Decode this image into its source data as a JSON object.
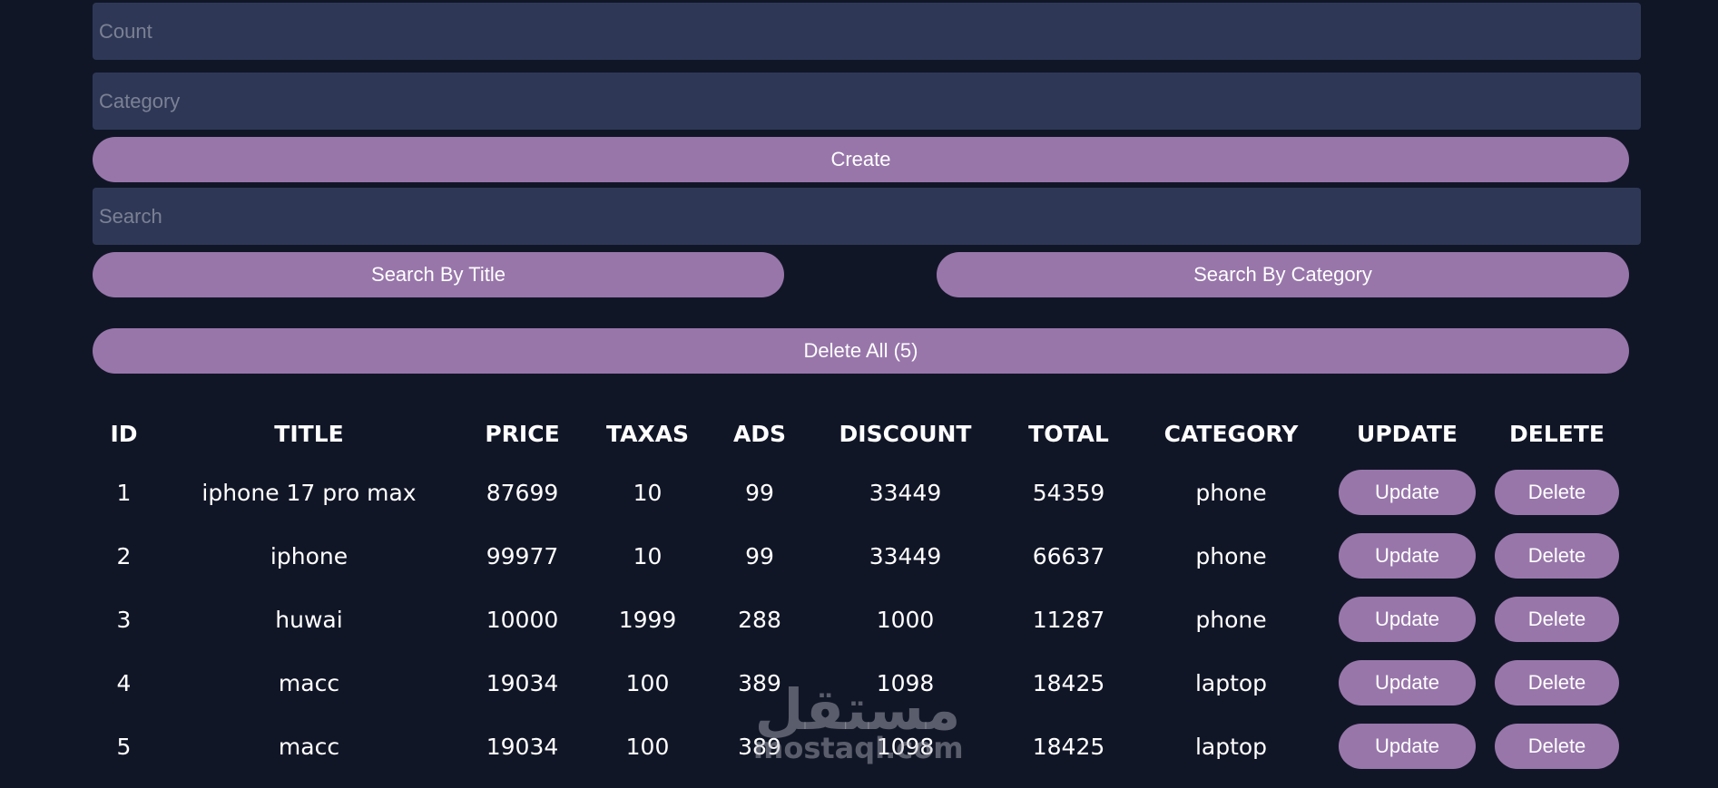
{
  "form": {
    "count_placeholder": "Count",
    "category_placeholder": "Category",
    "create_label": "Create",
    "search_placeholder": "Search",
    "search_by_title_label": "Search By Title",
    "search_by_category_label": "Search By Category",
    "delete_all_label": "Delete All (5)"
  },
  "table": {
    "headers": [
      "ID",
      "TITLE",
      "PRICE",
      "TAXAS",
      "ADS",
      "DISCOUNT",
      "TOTAL",
      "CATEGORY",
      "UPDATE",
      "DELETE"
    ],
    "rows": [
      {
        "id": "1",
        "title": "iphone 17 pro max",
        "price": "87699",
        "taxas": "10",
        "ads": "99",
        "discount": "33449",
        "total": "54359",
        "category": "phone",
        "update": "Update",
        "delete": "Delete"
      },
      {
        "id": "2",
        "title": "iphone",
        "price": "99977",
        "taxas": "10",
        "ads": "99",
        "discount": "33449",
        "total": "66637",
        "category": "phone",
        "update": "Update",
        "delete": "Delete"
      },
      {
        "id": "3",
        "title": "huwai",
        "price": "10000",
        "taxas": "1999",
        "ads": "288",
        "discount": "1000",
        "total": "11287",
        "category": "phone",
        "update": "Update",
        "delete": "Delete"
      },
      {
        "id": "4",
        "title": "macc",
        "price": "19034",
        "taxas": "100",
        "ads": "389",
        "discount": "1098",
        "total": "18425",
        "category": "laptop",
        "update": "Update",
        "delete": "Delete"
      },
      {
        "id": "5",
        "title": "macc",
        "price": "19034",
        "taxas": "100",
        "ads": "389",
        "discount": "1098",
        "total": "18425",
        "category": "laptop",
        "update": "Update",
        "delete": "Delete"
      }
    ]
  },
  "watermark": {
    "arabic": "مستقل",
    "latin": "mostaql.com"
  },
  "colors": {
    "background": "#111627",
    "input_background": "#2e3856",
    "button_accent": "#9876aa",
    "text": "#ffffff"
  }
}
